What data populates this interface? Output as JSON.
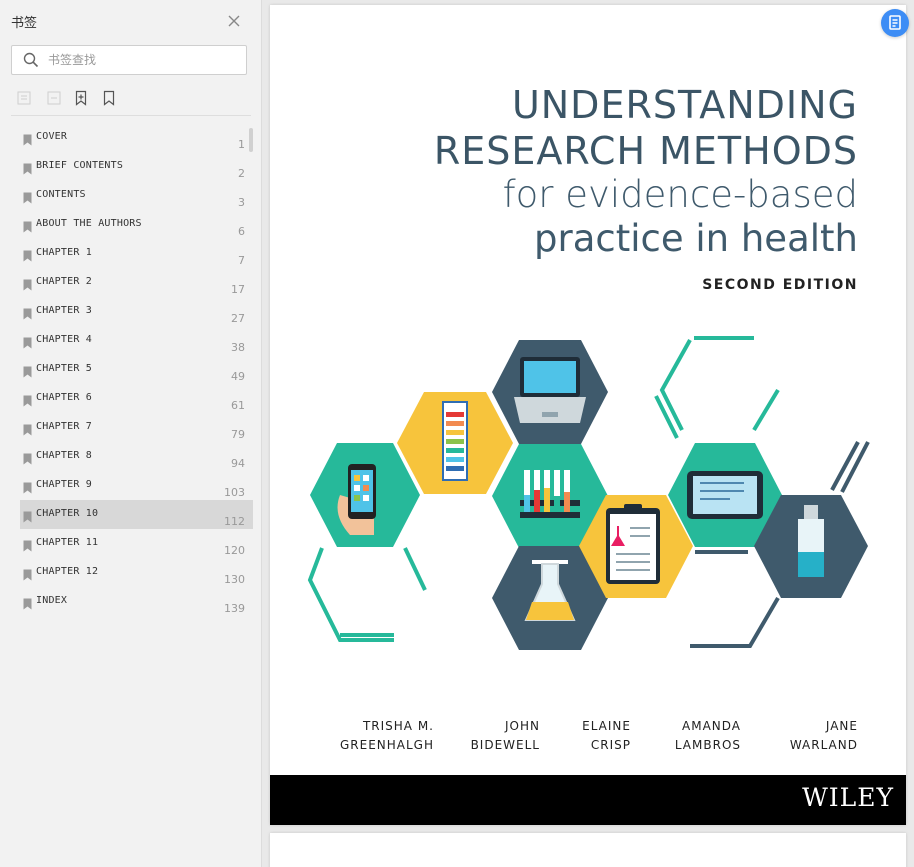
{
  "sidebar": {
    "title": "书签",
    "search": {
      "placeholder": "书签查找",
      "value": ""
    },
    "toolbar": [
      "expand-all-icon",
      "collapse-all-icon",
      "add-bookmark-icon",
      "bookmark-icon"
    ],
    "items": [
      {
        "label": "COVER",
        "page": "1",
        "selected": false
      },
      {
        "label": "BRIEF CONTENTS",
        "page": "2",
        "selected": false
      },
      {
        "label": "CONTENTS",
        "page": "3",
        "selected": false
      },
      {
        "label": "ABOUT THE AUTHORS",
        "page": "6",
        "selected": false
      },
      {
        "label": "CHAPTER 1",
        "page": "7",
        "selected": false
      },
      {
        "label": "CHAPTER 2",
        "page": "17",
        "selected": false
      },
      {
        "label": "CHAPTER 3",
        "page": "27",
        "selected": false
      },
      {
        "label": "CHAPTER 4",
        "page": "38",
        "selected": false
      },
      {
        "label": "CHAPTER 5",
        "page": "49",
        "selected": false
      },
      {
        "label": "CHAPTER 6",
        "page": "61",
        "selected": false
      },
      {
        "label": "CHAPTER 7",
        "page": "79",
        "selected": false
      },
      {
        "label": "CHAPTER 8",
        "page": "94",
        "selected": false
      },
      {
        "label": "CHAPTER 9",
        "page": "103",
        "selected": false
      },
      {
        "label": "CHAPTER 10",
        "page": "112",
        "selected": true
      },
      {
        "label": "CHAPTER 11",
        "page": "120",
        "selected": false
      },
      {
        "label": "CHAPTER 12",
        "page": "130",
        "selected": false
      },
      {
        "label": "INDEX",
        "page": "139",
        "selected": false
      }
    ]
  },
  "cover": {
    "title_line1": "UNDERSTANDING",
    "title_line2": "RESEARCH METHODS",
    "title_line3": "for evidence-based",
    "title_line4": "practice in health",
    "edition": "SECOND EDITION",
    "authors": [
      {
        "line1": "TRISHA M.",
        "line2": "GREENHALGH"
      },
      {
        "line1": "JOHN",
        "line2": "BIDEWELL"
      },
      {
        "line1": "ELAINE",
        "line2": "CRISP"
      },
      {
        "line1": "AMANDA",
        "line2": "LAMBROS"
      },
      {
        "line1": "JANE",
        "line2": "WARLAND"
      }
    ],
    "publisher": "WILEY"
  },
  "colors": {
    "teal": "#26b99a",
    "navy": "#3f5a6c",
    "yellow": "#f7c43c",
    "title": "#3b5566",
    "accent_blue": "#3d8df5"
  }
}
